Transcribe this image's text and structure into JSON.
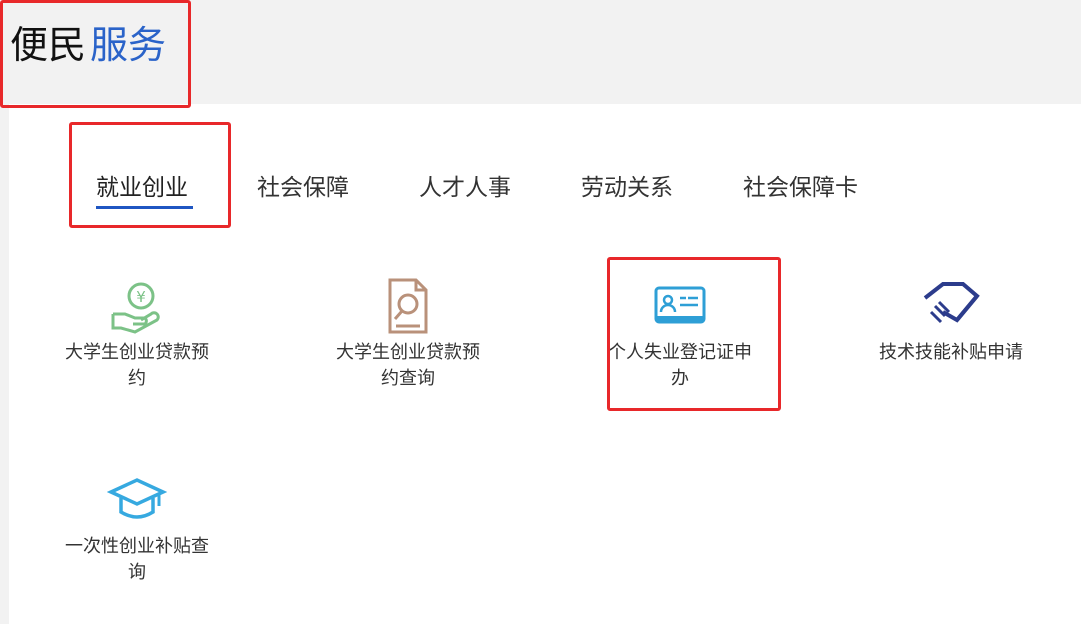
{
  "header": {
    "title_part1": "便民",
    "title_part2": "服务",
    "accent_color": "#2a63c9"
  },
  "tabs": [
    {
      "label": "就业创业",
      "active": true
    },
    {
      "label": "社会保障",
      "active": false
    },
    {
      "label": "人才人事",
      "active": false
    },
    {
      "label": "劳动关系",
      "active": false
    },
    {
      "label": "社会保障卡",
      "active": false
    }
  ],
  "services": [
    {
      "label": "大学生创业贷款预约",
      "icon": "money-hand-icon"
    },
    {
      "label": "大学生创业贷款预约查询",
      "icon": "document-search-icon"
    },
    {
      "label": "个人失业登记证申办",
      "icon": "id-card-icon"
    },
    {
      "label": "技术技能补贴申请",
      "icon": "handshake-icon"
    },
    {
      "label": "一次性创业补贴查询",
      "icon": "graduation-cap-icon"
    }
  ],
  "highlight_color": "#e8282a"
}
